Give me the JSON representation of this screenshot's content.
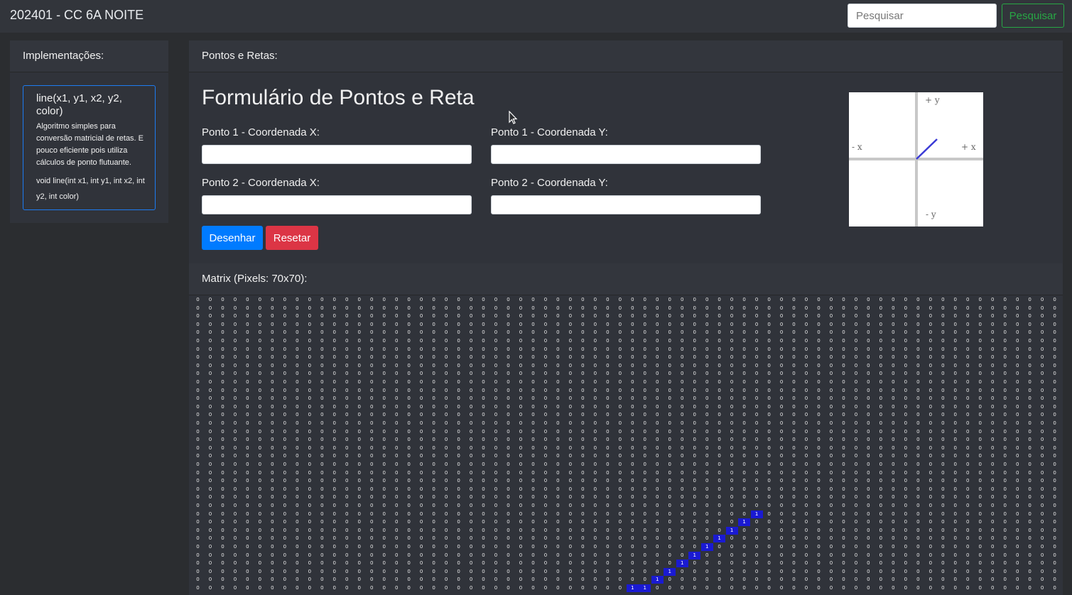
{
  "navbar": {
    "brand": "202401 - CC 6A NOITE",
    "search_placeholder": "Pesquisar",
    "search_button": "Pesquisar"
  },
  "sidebar": {
    "header": "Implementações:",
    "implementation": {
      "title": "line(x1, y1, x2, y2, color)",
      "description": "Algoritmo simples para conversão matricial de retas. E pouco eficiente pois utiliza cálculos de ponto flutuante.",
      "signature": "void line(int x1, int y1, int x2, int y2, int color)"
    }
  },
  "main": {
    "header": "Pontos e Retas:",
    "form": {
      "title": "Formulário de Pontos e Reta",
      "p1x_label": "Ponto 1 - Coordenada X:",
      "p1y_label": "Ponto 1 - Coordenada Y:",
      "p2x_label": "Ponto 2 - Coordenada X:",
      "p2y_label": "Ponto 2 - Coordenada Y:",
      "p1x_value": "",
      "p1y_value": "",
      "p2x_value": "",
      "p2y_value": "",
      "draw_button": "Desenhar",
      "reset_button": "Resetar"
    },
    "axes_image": {
      "plus_y": "+ y",
      "minus_x": "- x",
      "plus_x": "+ x",
      "minus_y": "- y"
    },
    "matrix": {
      "header": "Matrix (Pixels: 70x70):",
      "columns": 70,
      "visible_rows": 36,
      "off_value": "0",
      "on_value": "1",
      "on_color": "#1a1ad2",
      "lit_cells": [
        [
          26,
          45
        ],
        [
          27,
          44
        ],
        [
          28,
          43
        ],
        [
          29,
          42
        ],
        [
          30,
          41
        ],
        [
          31,
          40
        ],
        [
          32,
          39
        ],
        [
          33,
          38
        ],
        [
          34,
          37
        ],
        [
          35,
          36
        ],
        [
          35,
          35
        ]
      ]
    }
  },
  "colors": {
    "background": "#2b2d30",
    "panel": "#30333a",
    "primary": "#007bff",
    "danger": "#dc3545",
    "success": "#28a745",
    "card_border": "#1d7cf2"
  }
}
